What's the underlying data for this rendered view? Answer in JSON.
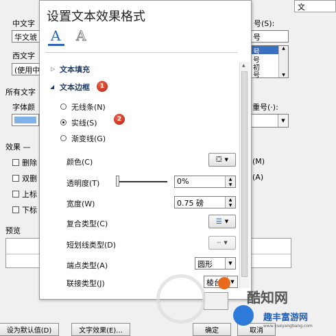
{
  "background_dialog": {
    "left": {
      "chinese_font_label": "中文字",
      "chinese_font_value": "华文琥",
      "western_font_label": "西文字",
      "western_font_value": "(使用中",
      "all_text_label": "所有文字",
      "font_color_label": "字体颜",
      "effects_label": "效果 —",
      "effect_items": [
        "删除",
        "双删",
        "上标",
        "下标"
      ],
      "preview_label": "预览"
    },
    "right": {
      "top_box": "文",
      "size_label": "号(S):",
      "size_items": [
        "号",
        "号",
        "初",
        "号"
      ],
      "size_field": "号",
      "emphasis_label": "重号(·):",
      "check1": "(M)",
      "check2": "(A)"
    },
    "bottom": {
      "default_button": "设为默认值(D)",
      "text_effects_button": "文字效果(E)...",
      "ok_button": "确定",
      "cancel_button": "取消"
    }
  },
  "panel": {
    "title": "设置文本效果格式",
    "icon_fill_text": "A",
    "icon_outline_text": "A",
    "sections": {
      "fill": "文本填充",
      "border": "文本边框"
    },
    "radios": {
      "none": "无线条(N)",
      "solid": "实线(S)",
      "gradient": "渐变线(G)"
    },
    "props": {
      "color_label": "颜色(C)",
      "transparency_label": "透明度(T)",
      "transparency_value": "0%",
      "width_label": "宽度(W)",
      "width_value": "0.75 磅",
      "compound_label": "复合类型(C)",
      "dash_label": "短划线类型(D)",
      "cap_label": "端点类型(A)",
      "cap_value": "圆形",
      "join_label": "联接类型(J)",
      "join_value": "棱台"
    },
    "badges": [
      "1",
      "2"
    ]
  },
  "watermarks": {
    "brand1": "酷知网",
    "brand2": "趣丰富游网",
    "url": "www.yueyangbang.com"
  },
  "colors": {
    "accent": "#2b63b6",
    "badge": "#c62a14",
    "font_color_swatch": "#7fb0e6"
  }
}
